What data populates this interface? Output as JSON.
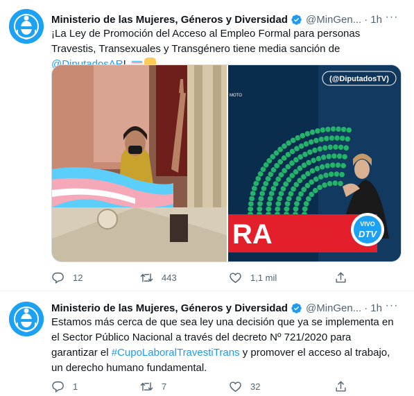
{
  "colors": {
    "accent": "#1d9bf0",
    "secondary_text": "#536471",
    "divider": "#eff3f4"
  },
  "tweets": [
    {
      "author": {
        "name": "Ministerio de las Mujeres, Géneros y Diversidad",
        "handle": "@MinGen...",
        "avatar_icon": "argentina-coat-of-arms-icon",
        "verified_icon": "verified-badge-icon"
      },
      "time": "1h",
      "separator": "·",
      "more_icon": "more-options-icon",
      "text_parts": {
        "part1": "¡La Ley de Promoción del Acceso al Empleo Formal para personas Travestis, Transexuales y Transgénero tiene media sanción de ",
        "mention": "@DiputadosAR",
        "part2": "!"
      },
      "media": {
        "right_image": {
          "watermark": "@DiputadosTV",
          "label": "MOTO",
          "banner_text": "RA",
          "badge_top": "VIVO",
          "badge_bottom": "DTV"
        }
      },
      "actions": {
        "reply": "12",
        "retweet": "443",
        "like": "1,1 mil",
        "share": ""
      }
    },
    {
      "author": {
        "name": "Ministerio de las Mujeres, Géneros y Diversidad",
        "handle": "@MinGen...",
        "avatar_icon": "argentina-coat-of-arms-icon",
        "verified_icon": "verified-badge-icon"
      },
      "time": "1h",
      "separator": "·",
      "more_icon": "more-options-icon",
      "text_parts": {
        "part1": "Estamos más cerca de que sea ley una decisión que ya se implementa en el Sector Público Nacional a través del decreto Nº 721/2020 para garantizar el ",
        "hashtag": "#CupoLaboralTravestiTrans",
        "part2": " y promover el acceso al trabajo, un derecho humano fundamental."
      },
      "actions": {
        "reply": "1",
        "retweet": "7",
        "like": "32",
        "share": ""
      }
    }
  ]
}
